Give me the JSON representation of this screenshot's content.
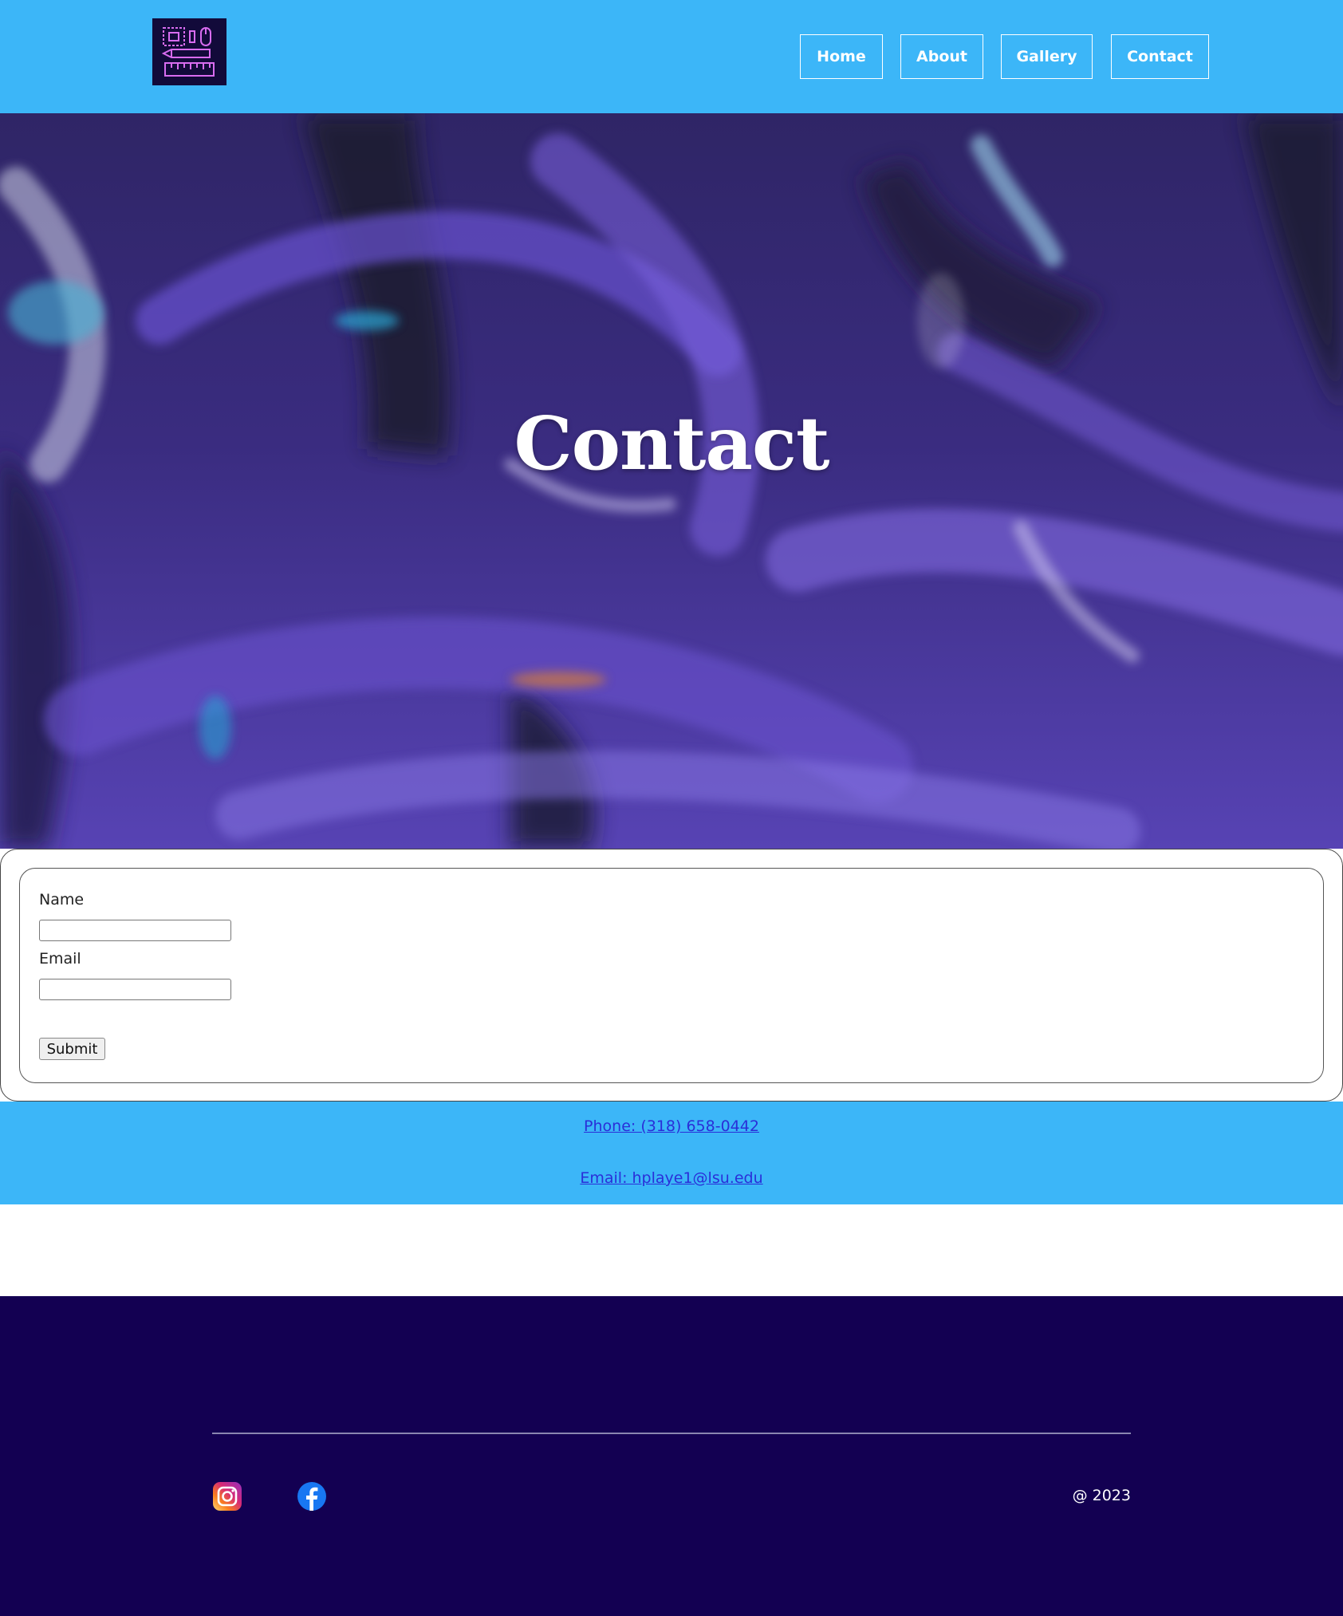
{
  "header": {
    "logo_icon": "design-tools-icon",
    "nav": [
      {
        "label": "Home"
      },
      {
        "label": "About"
      },
      {
        "label": "Gallery"
      },
      {
        "label": "Contact"
      }
    ]
  },
  "hero": {
    "title": "Contact"
  },
  "form": {
    "name_label": "Name",
    "name_value": "",
    "name_placeholder": "",
    "email_label": "Email",
    "email_value": "",
    "email_placeholder": "",
    "submit_label": "Submit"
  },
  "contact": {
    "phone": "Phone: (318) 658-0442",
    "email": "Email: hplaye1@lsu.edu"
  },
  "footer": {
    "social": [
      {
        "icon": "instagram-icon"
      },
      {
        "icon": "facebook-icon"
      }
    ],
    "copyright": "@ 2023"
  },
  "colors": {
    "accent": "#3cb6f8",
    "footer_bg": "#130052",
    "hero_purple": "#5a3fc0",
    "link": "#2a2fd8"
  }
}
